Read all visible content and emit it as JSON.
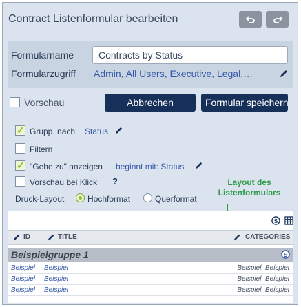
{
  "header": {
    "title": "Contract Listenformular bearbeiten",
    "undo_icon": "undo-icon",
    "redo_icon": "redo-icon"
  },
  "settings": {
    "name_label": "Formularname",
    "name_value": "Contracts by Status",
    "access_label": "Formularzugriff",
    "access_value": "Admin, All Users, Executive, Legal,…"
  },
  "actions": {
    "preview_label": "Vorschau",
    "cancel_label": "Abbrechen",
    "save_label": "Formular speichern"
  },
  "options": {
    "group_by_label": "Grupp. nach",
    "group_by_value": "Status",
    "filter_label": "Filtern",
    "goto_label": "\"Gehe zu\" anzeigen",
    "goto_value": "beginnt mit: Status",
    "preview_click_label": "Vorschau bei Klick",
    "help": "?",
    "print_layout_label": "Druck-Layout",
    "portrait_label": "Hochformat",
    "landscape_label": "Querformat"
  },
  "annotation": {
    "line1": "Layout des",
    "line2": "Listenformulars"
  },
  "table": {
    "columns": [
      "ID",
      "TITLE",
      "CATEGORIES"
    ],
    "group_title": "Beispielgruppe 1",
    "rows": [
      {
        "id": "Beispiel",
        "title": "Beispiel",
        "categories": "Beispiel, Beispiel"
      },
      {
        "id": "Beispiel",
        "title": "Beispiel",
        "categories": "Beispiel, Beispiel"
      },
      {
        "id": "Beispiel",
        "title": "Beispiel",
        "categories": "Beispiel, Beispiel"
      }
    ]
  },
  "colors": {
    "accent_dark": "#17305a",
    "link": "#3557a8",
    "annotation": "#2f9a4a",
    "check": "#8dc12e"
  }
}
